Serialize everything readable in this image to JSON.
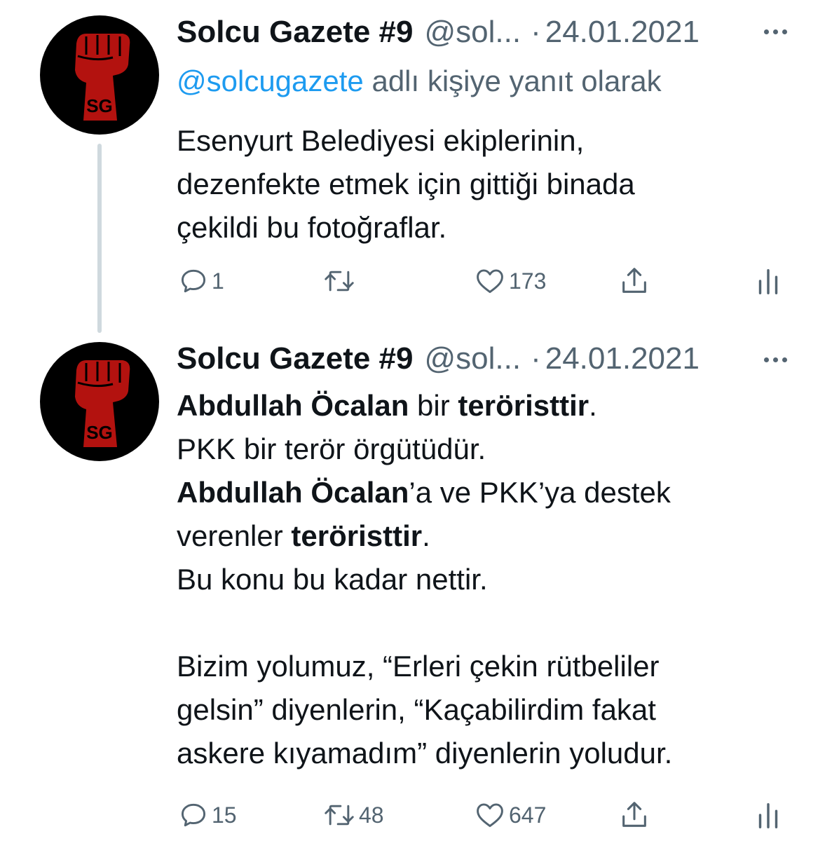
{
  "tweets": [
    {
      "name": "Solcu Gazete #9",
      "handle": "@sol...",
      "separator": "·",
      "date": "24.01.2021",
      "reply_to": {
        "mention": "@solcugazete",
        "suffix": " adlı kişiye yanıt olarak"
      },
      "body_lines": [
        "Esenyurt Belediyesi ekiplerinin,",
        "dezenfekte etmek için gittiği binada",
        "çekildi bu fotoğraflar."
      ],
      "actions": {
        "reply_count": "1",
        "retweet_count": "",
        "like_count": "173"
      }
    },
    {
      "name": "Solcu Gazete #9",
      "handle": "@sol...",
      "separator": "·",
      "date": "24.01.2021",
      "body": {
        "l1_bold1": "Abdullah Öcalan",
        "l1_text": " bir ",
        "l1_bold2": "teröristtir",
        "l1_end": ".",
        "l2": "PKK bir terör örgütüdür.",
        "l3_bold": "Abdullah Öcalan",
        "l3_text": "’a ve PKK’ya destek",
        "l4_text": "verenler ",
        "l4_bold": "teröristtir",
        "l4_end": ".",
        "l5": "Bu konu bu kadar nettir.",
        "l7": "Bizim yolumuz, “Erleri çekin rütbeliler",
        "l8": "gelsin” diyenlerin, “Kaçabilirdim fakat",
        "l9": "askere kıyamadım” diyenlerin yoludur."
      },
      "actions": {
        "reply_count": "15",
        "retweet_count": "48",
        "like_count": "647"
      }
    }
  ],
  "avatar": {
    "logo_text": "SG",
    "background": "#000000",
    "fist_color": "#b3120f"
  },
  "colors": {
    "text": "#0f1419",
    "secondary": "#536471",
    "link": "#1d9bf0",
    "thread_line": "#cfd9de"
  },
  "icons": [
    "reply-icon",
    "retweet-icon",
    "like-icon",
    "share-icon",
    "analytics-icon",
    "more-icon"
  ]
}
